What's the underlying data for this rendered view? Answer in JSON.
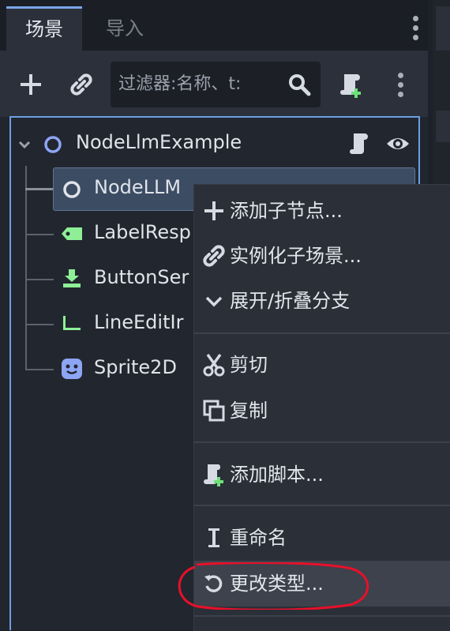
{
  "tabs": {
    "scene": "场景",
    "import": "导入"
  },
  "toolbar": {
    "filter_placeholder": "过滤器:名称、t:"
  },
  "tree": {
    "root": "NodeLlmExample",
    "selected": "NodeLLM",
    "children": [
      "LabelResp",
      "ButtonSer",
      "LineEditIr",
      "Sprite2D"
    ]
  },
  "menu": {
    "add_child": "添加子节点...",
    "instantiate": "实例化子场景...",
    "expand_collapse": "展开/折叠分支",
    "cut": "剪切",
    "copy": "复制",
    "add_script": "添加脚本...",
    "rename": "重命名",
    "change_type": "更改类型..."
  },
  "colors": {
    "accent": "#6d9ee6",
    "node_blue": "#8da5f3",
    "node_green": "#8eef97",
    "annotation_red": "#e8102a"
  },
  "icons": [
    "plus-icon",
    "link-icon",
    "search-icon",
    "add-script-icon",
    "kebab-icon",
    "node-icon",
    "script-icon",
    "eye-icon",
    "label-icon",
    "button-icon",
    "line-edit-icon",
    "sprite-icon",
    "scissors-icon",
    "copy-icon",
    "rename-icon",
    "change-type-icon",
    "chevron-down-icon"
  ]
}
